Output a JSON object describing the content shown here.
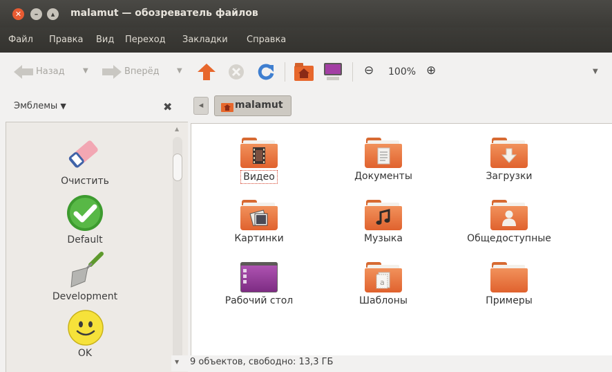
{
  "window": {
    "title": "malamut — обозреватель файлов",
    "controls": [
      "close-icon",
      "minimize-icon",
      "maximize-icon"
    ],
    "accent_colors": {
      "close": "#e85b32",
      "other": "#c6c2b9"
    }
  },
  "menubar": {
    "items": [
      "Файл",
      "Правка",
      "Вид",
      "Переход",
      "Закладки",
      "Справка"
    ]
  },
  "toolbar": {
    "back_label": "Назад",
    "forward_label": "Вперёд",
    "zoom_level": "100%",
    "icons": [
      "up-arrow-icon",
      "stop-icon",
      "reload-icon",
      "home-folder-icon",
      "computer-icon",
      "zoom-out-icon",
      "zoom-in-icon"
    ]
  },
  "sidebar": {
    "header": "Эмблемы",
    "header_arrow": "▼",
    "close_glyph": "✖",
    "emblems": [
      {
        "label": "Очистить",
        "icon": "eraser-icon"
      },
      {
        "label": "Default",
        "icon": "checkmark-icon"
      },
      {
        "label": "Development",
        "icon": "trowel-icon"
      },
      {
        "label": "OK",
        "icon": "smiley-icon"
      }
    ]
  },
  "pathbar": {
    "current": "malamut",
    "back_glyph": "◂"
  },
  "files": [
    {
      "name": "Видео",
      "emblem": "film-icon",
      "selected": true
    },
    {
      "name": "Документы",
      "emblem": "document-icon"
    },
    {
      "name": "Загрузки",
      "emblem": "download-icon"
    },
    {
      "name": "Картинки",
      "emblem": "pictures-icon"
    },
    {
      "name": "Музыка",
      "emblem": "music-icon"
    },
    {
      "name": "Общедоступные",
      "emblem": "person-icon"
    },
    {
      "name": "Рабочий стол",
      "emblem": "desktop-icon"
    },
    {
      "name": "Шаблоны",
      "emblem": "template-icon"
    },
    {
      "name": "Примеры",
      "emblem": "none"
    }
  ],
  "status": {
    "text": "9 объектов, свободно: 13,3 ГБ"
  }
}
